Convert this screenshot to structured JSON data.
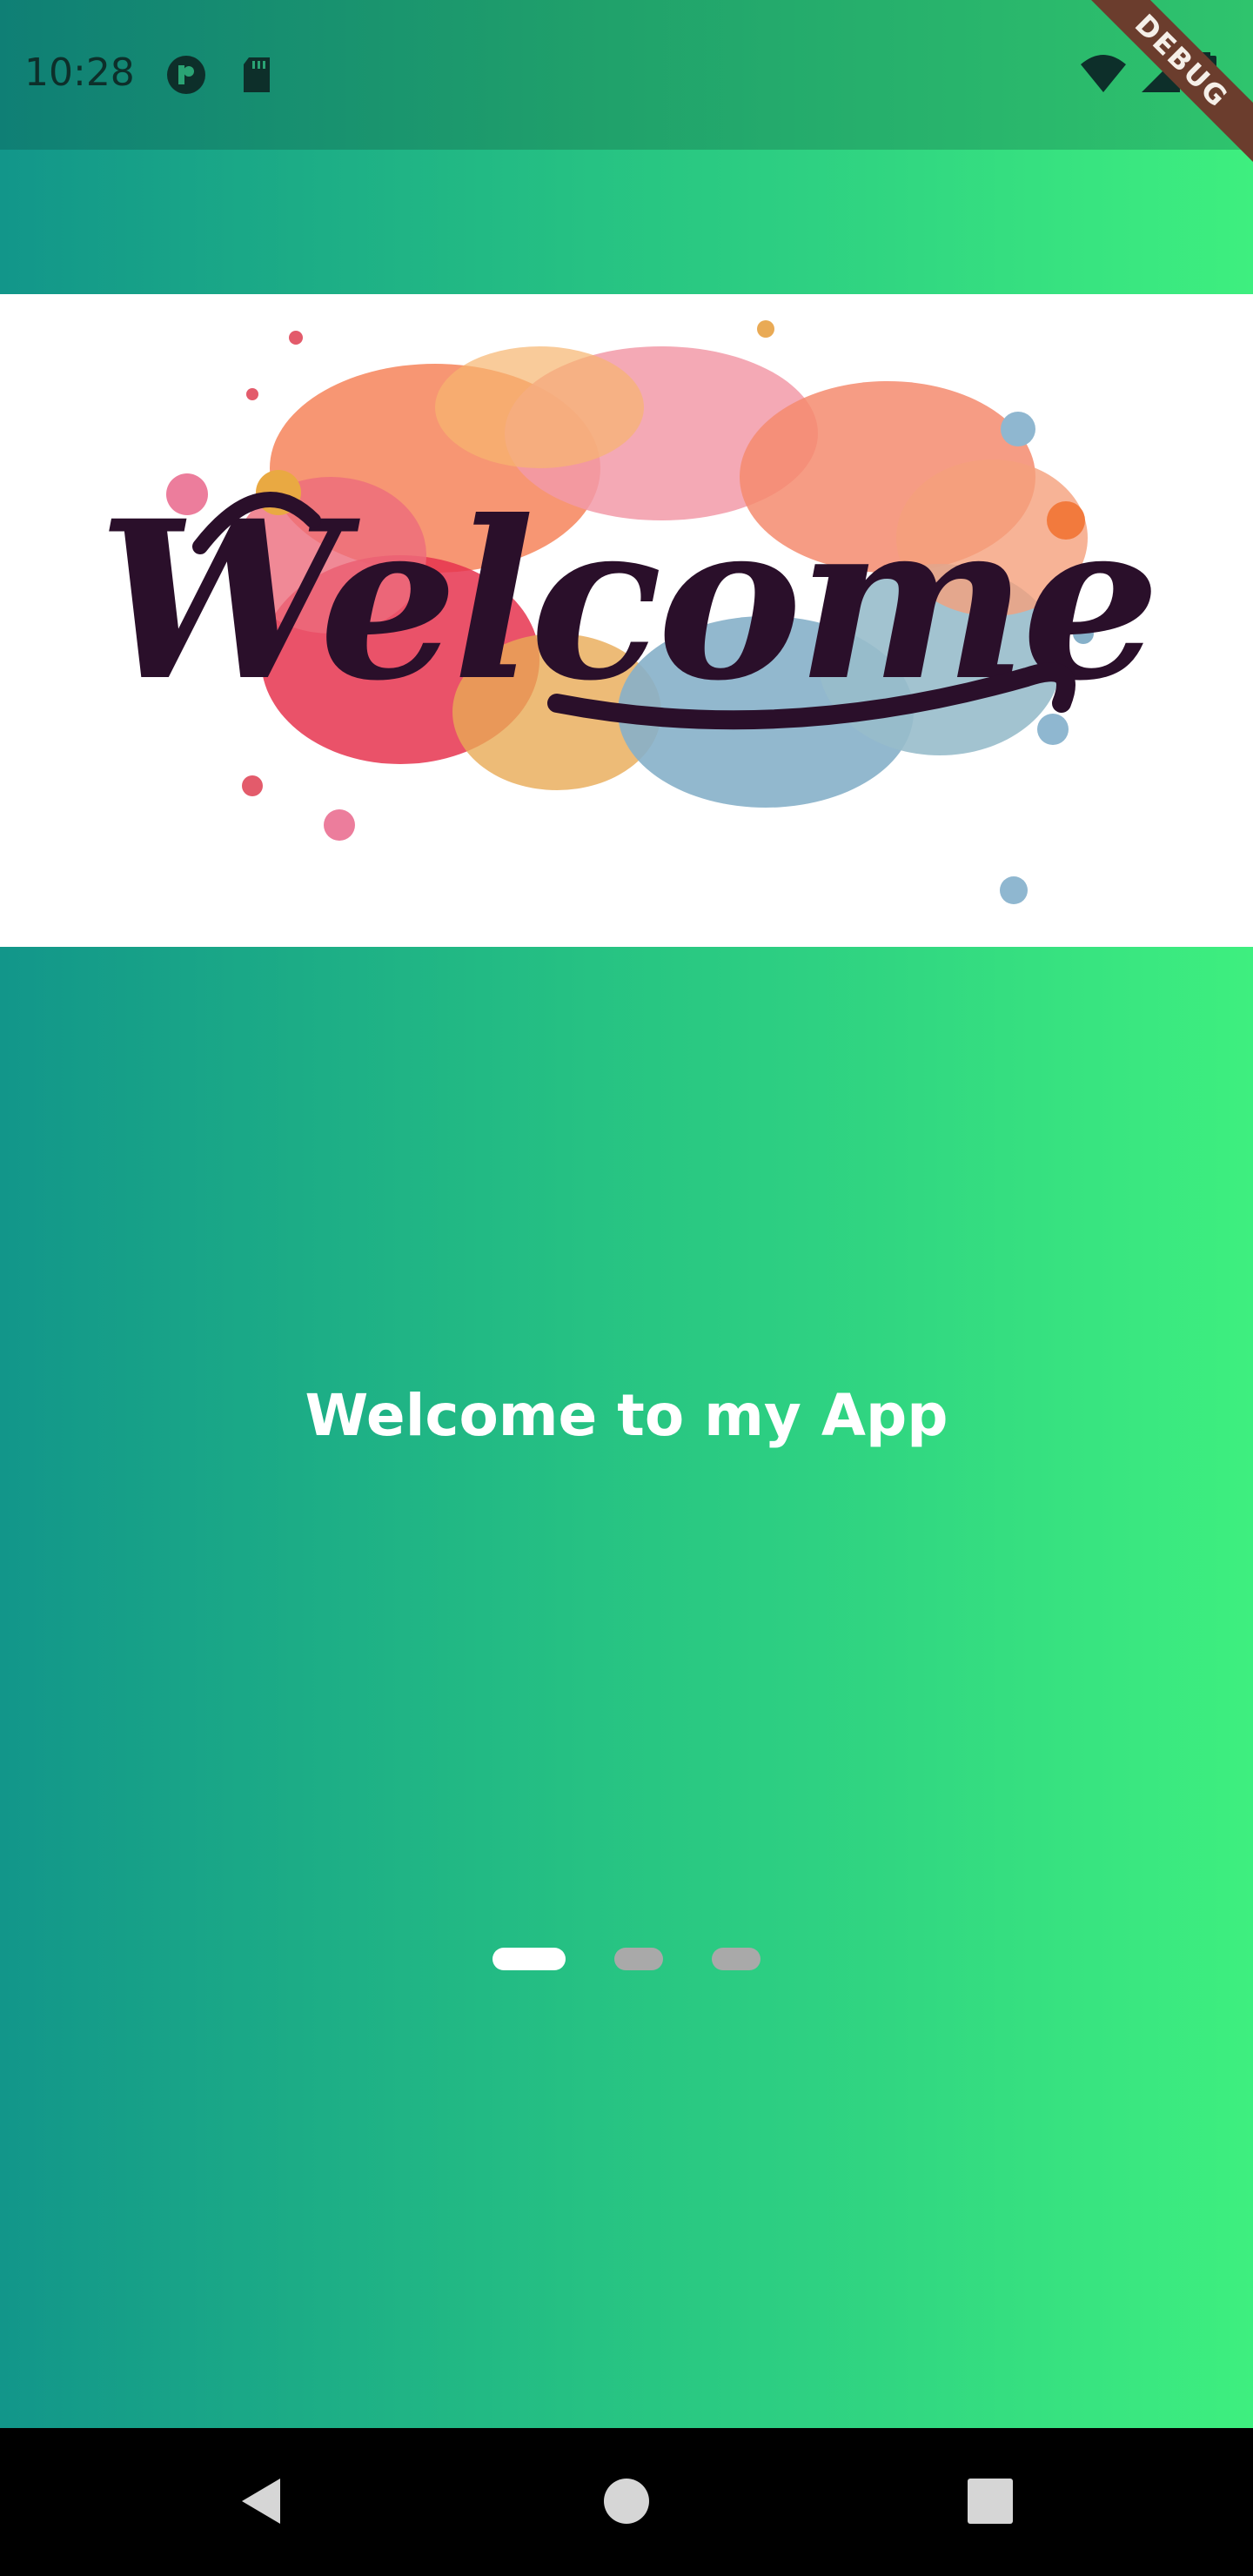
{
  "status_bar": {
    "time": "10:28",
    "debug_banner": "DEBUG",
    "icons": [
      "vpn-icon",
      "sd-card-icon",
      "wifi-icon",
      "signal-icon",
      "battery-icon"
    ]
  },
  "hero": {
    "image_alt": "Welcome",
    "lettering": "Welcome"
  },
  "headline": "Welcome to my App",
  "page_indicator": {
    "count": 3,
    "active_index": 0
  },
  "nav_bar": {
    "buttons": [
      "back-icon",
      "home-icon",
      "recents-icon"
    ]
  },
  "colors": {
    "gradient_start": "#12968a",
    "gradient_end": "#3eef7f",
    "headline": "#ffffff",
    "indicator_active": "#ffffff",
    "indicator_inactive": "#a9a9a9",
    "lettering": "#2a0f2a"
  }
}
